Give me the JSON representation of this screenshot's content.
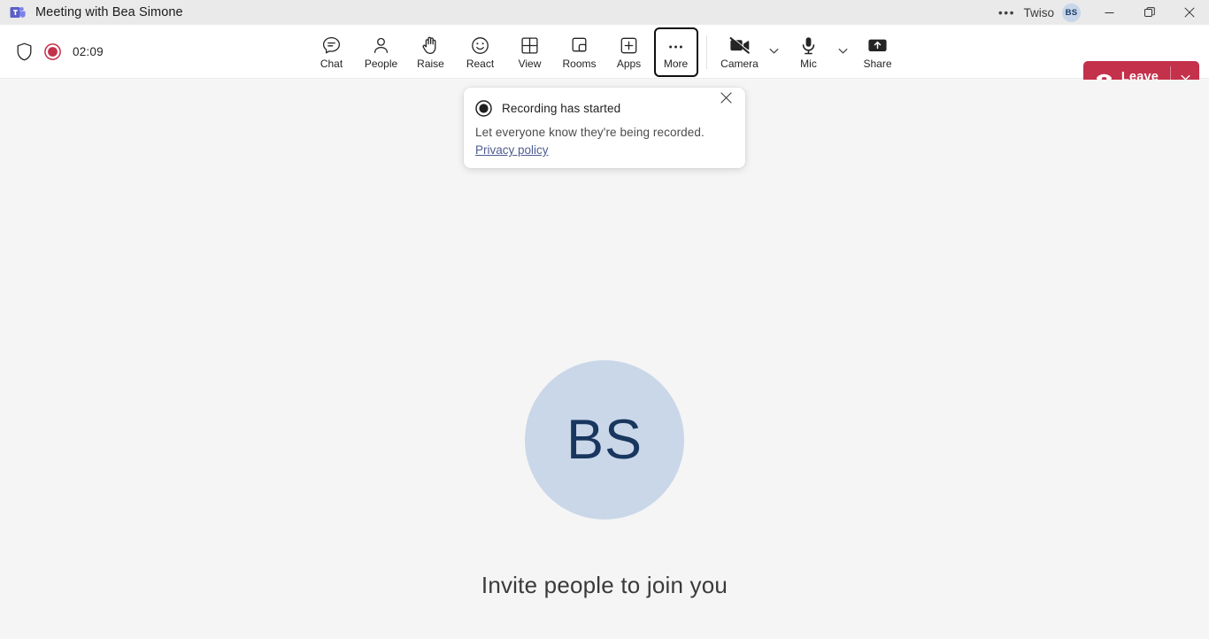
{
  "titlebar": {
    "app_icon": "teams-logo-icon",
    "title": "Meeting with Bea Simone",
    "overflow_label": "•••",
    "org_name": "Twiso",
    "account_initials": "BS",
    "window_controls": {
      "minimize": "minimize-icon",
      "restore": "restore-icon",
      "close": "close-icon"
    }
  },
  "toolbar": {
    "shield_icon": "shield-icon",
    "recording_indicator": "record-dot-icon",
    "timer": "02:09",
    "buttons": [
      {
        "id": "chat",
        "label": "Chat",
        "icon": "chat-bubble-icon"
      },
      {
        "id": "people",
        "label": "People",
        "icon": "person-icon"
      },
      {
        "id": "raise",
        "label": "Raise",
        "icon": "raise-hand-icon"
      },
      {
        "id": "react",
        "label": "React",
        "icon": "smiley-icon"
      },
      {
        "id": "view",
        "label": "View",
        "icon": "grid-icon"
      },
      {
        "id": "rooms",
        "label": "Rooms",
        "icon": "breakout-rooms-icon"
      },
      {
        "id": "apps",
        "label": "Apps",
        "icon": "plus-box-icon"
      },
      {
        "id": "more",
        "label": "More",
        "icon": "ellipsis-icon",
        "focused": true
      }
    ],
    "camera": {
      "label": "Camera",
      "icon": "camera-off-icon",
      "state": "off"
    },
    "mic": {
      "label": "Mic",
      "icon": "microphone-icon",
      "state": "on"
    },
    "share": {
      "label": "Share",
      "icon": "share-screen-icon"
    },
    "leave": {
      "label": "Leave",
      "icon": "hangup-icon",
      "color": "#c4314b"
    }
  },
  "toast": {
    "icon": "record-circle-icon",
    "title": "Recording has started",
    "body": "Let everyone know they're being recorded.",
    "link": "Privacy policy",
    "close_icon": "close-icon"
  },
  "stage": {
    "avatar_initials": "BS",
    "avatar_color": "#c9d7e8",
    "avatar_text_color": "#18365e",
    "invite_text": "Invite people to join you"
  }
}
